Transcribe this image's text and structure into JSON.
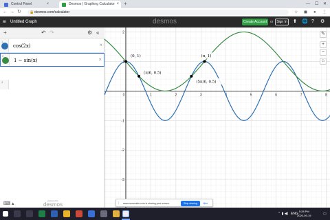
{
  "browser": {
    "tabs": [
      {
        "title": "Control Panel",
        "favicon_color": "#4a6fd3",
        "active": false
      },
      {
        "title": "Desmos | Graphing Calculator",
        "favicon_color": "#2f9e44",
        "active": true
      }
    ],
    "url": "desmos.com/calculator"
  },
  "header": {
    "title": "Untitled Graph",
    "brand": "desmos",
    "create_account": "Create Account",
    "or": "or",
    "sign_in": "Sign In"
  },
  "expressions": [
    {
      "index": "1",
      "latex": "cos(2x)",
      "color": "#2d70b3"
    },
    {
      "index": "2",
      "latex": "1 − sin(x)",
      "color": "#388c46"
    },
    {
      "index": "3"
    }
  ],
  "panel": {
    "powered_by": "powered by",
    "powered_name": "desmos"
  },
  "graph": {
    "x_ticks": [
      "0",
      "1",
      "2",
      "3",
      "4",
      "5",
      "6",
      "7",
      "8"
    ],
    "y_ticks": [
      "2",
      "1",
      "-1",
      "-2",
      "-3"
    ],
    "points": [
      {
        "label": "(0, 1)",
        "x": 0,
        "y": 1
      },
      {
        "label": "(π/6, 0.5)",
        "x": 0.5236,
        "y": 0.5
      },
      {
        "label": "(5π/6, 0.5)",
        "x": 2.618,
        "y": 0.5
      },
      {
        "label": "(π, 1)",
        "x": 3.1416,
        "y": 1
      }
    ],
    "x_range": [
      -0.85,
      8.15
    ],
    "y_range": [
      -3.95,
      2.15
    ],
    "colors": {
      "blue": "#2d70b3",
      "green": "#388c46",
      "axis": "#000000",
      "grid": "#e6e6e6"
    }
  },
  "share_notice": {
    "text": "www.numerade.com is sharing your screen.",
    "stop": "Stop sharing",
    "hide": "Hide"
  },
  "taskbar": {
    "language": "ENG",
    "time": "5:28 PM",
    "date": "2020-09-19"
  }
}
